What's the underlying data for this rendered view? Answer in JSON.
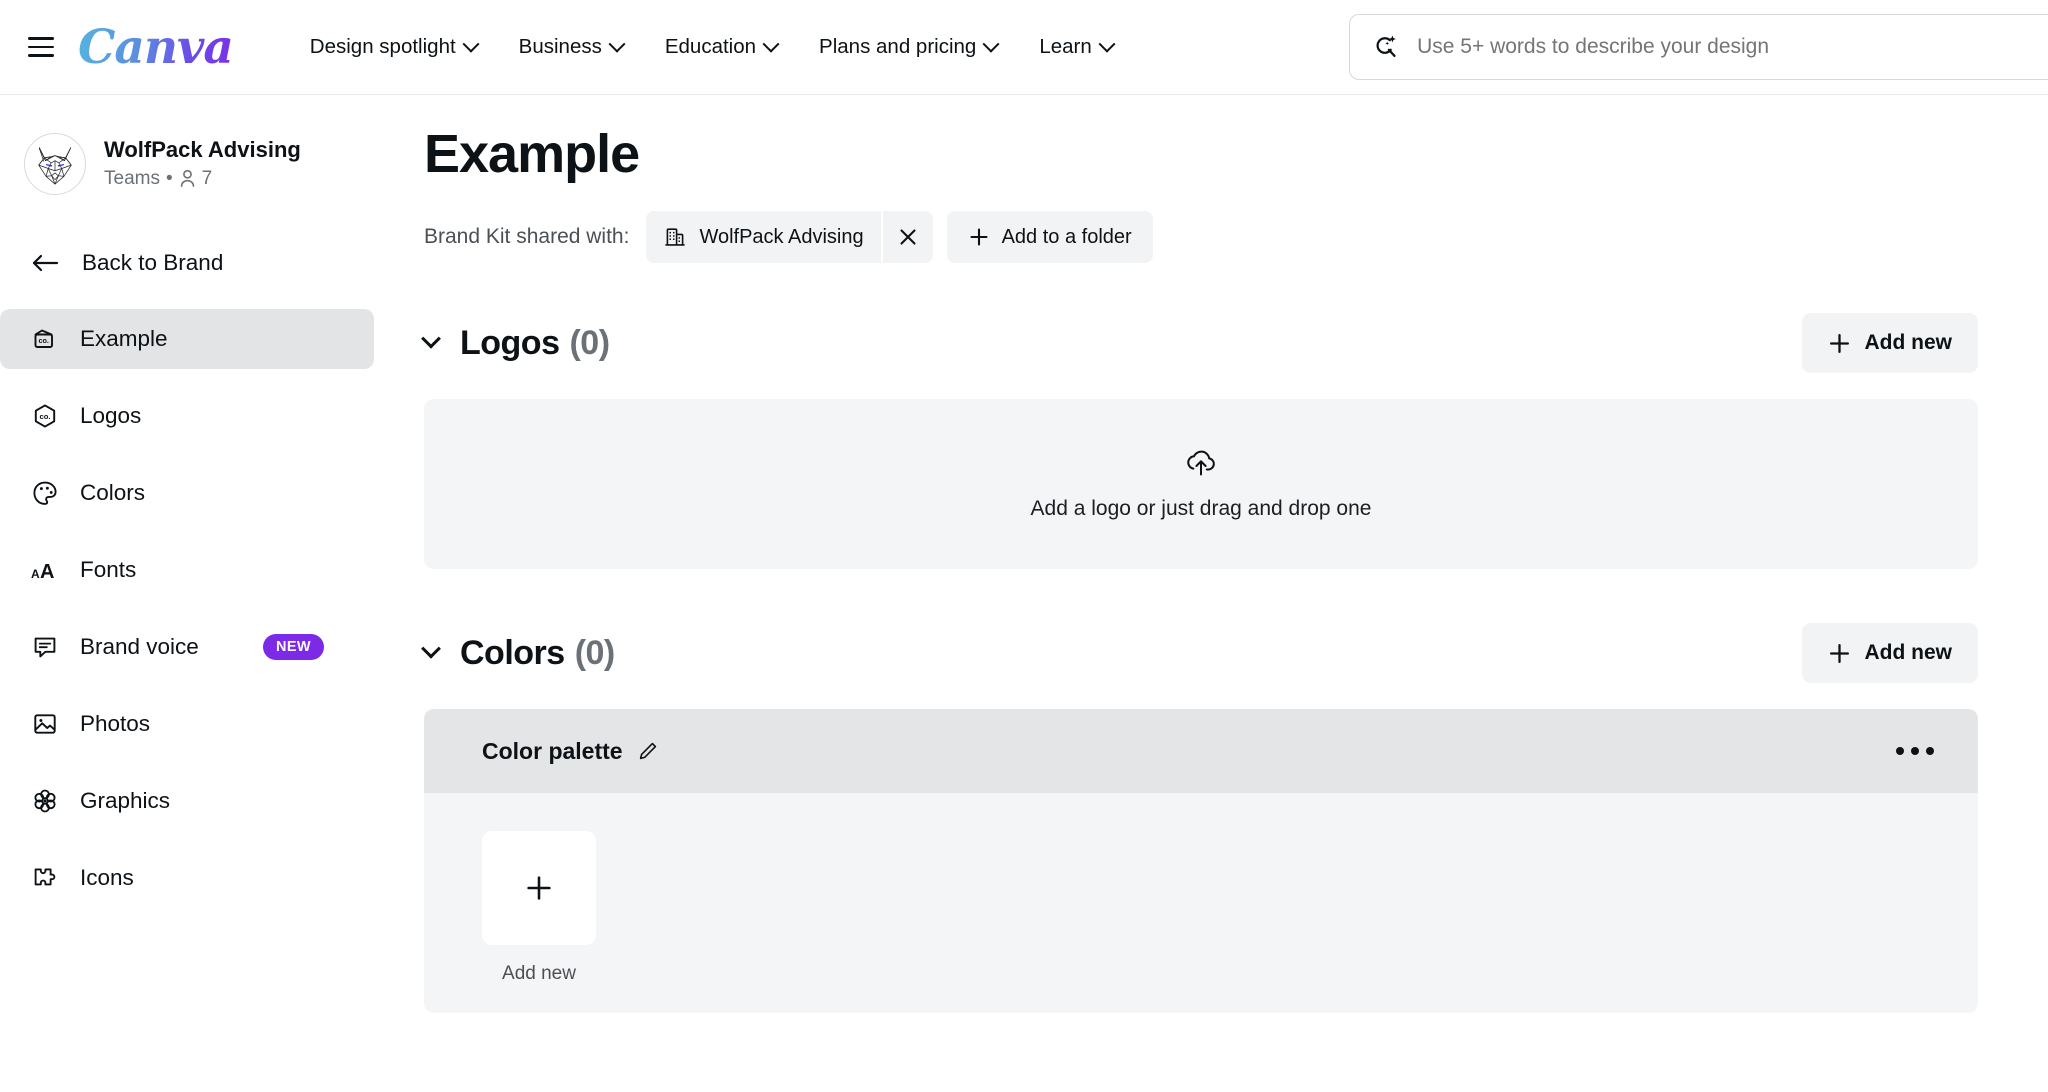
{
  "topnav": {
    "menu_icon": "hamburger-icon",
    "logo_text": "Canva",
    "items": [
      {
        "label": "Design spotlight",
        "icon": "chevron-down-icon"
      },
      {
        "label": "Business",
        "icon": "chevron-down-icon"
      },
      {
        "label": "Education",
        "icon": "chevron-down-icon"
      },
      {
        "label": "Plans and pricing",
        "icon": "chevron-down-icon"
      },
      {
        "label": "Learn",
        "icon": "chevron-down-icon"
      }
    ],
    "search": {
      "icon": "ai-search-icon",
      "placeholder": "Use 5+ words to describe your design",
      "value": ""
    }
  },
  "sidebar": {
    "team": {
      "avatar_icon": "wolf-head-avatar",
      "name": "WolfPack Advising",
      "type": "Teams",
      "separator": "•",
      "members_icon": "person-icon",
      "members_count": "7"
    },
    "back": {
      "icon": "arrow-left-icon",
      "label": "Back to Brand"
    },
    "items": [
      {
        "label": "Example",
        "icon": "brand-kit-icon",
        "active": true,
        "badge": ""
      },
      {
        "label": "Logos",
        "icon": "logo-hexagon-icon",
        "active": false,
        "badge": ""
      },
      {
        "label": "Colors",
        "icon": "palette-icon",
        "active": false,
        "badge": ""
      },
      {
        "label": "Fonts",
        "icon": "font-size-icon",
        "active": false,
        "badge": ""
      },
      {
        "label": "Brand voice",
        "icon": "speech-bubble-icon",
        "active": false,
        "badge": "NEW"
      },
      {
        "label": "Photos",
        "icon": "photo-icon",
        "active": false,
        "badge": ""
      },
      {
        "label": "Graphics",
        "icon": "flower-icon",
        "active": false,
        "badge": ""
      },
      {
        "label": "Icons",
        "icon": "puzzle-piece-icon",
        "active": false,
        "badge": ""
      }
    ]
  },
  "main": {
    "title": "Example",
    "shared": {
      "label": "Brand Kit shared with:",
      "chip_icon": "office-building-icon",
      "chip_text": "WolfPack Advising",
      "chip_remove_icon": "close-icon",
      "add_folder_icon": "plus-icon",
      "add_folder_label": "Add to a folder"
    },
    "logos_section": {
      "collapse_icon": "chevron-down-icon",
      "title": "Logos",
      "count": "(0)",
      "add_new_icon": "plus-icon",
      "add_new_label": "Add new",
      "dropzone_icon": "cloud-upload-icon",
      "dropzone_text": "Add a logo or just drag and drop one"
    },
    "colors_section": {
      "collapse_icon": "chevron-down-icon",
      "title": "Colors",
      "count": "(0)",
      "add_new_icon": "plus-icon",
      "add_new_label": "Add new",
      "palette": {
        "name": "Color palette",
        "edit_icon": "pencil-icon",
        "more_icon": "more-horizontal-icon",
        "add_swatch_icon": "plus-icon",
        "add_swatch_label": "Add new"
      }
    }
  },
  "colors": {
    "accent_purple": "#7d2ae8",
    "logo_gradient_start": "#56b4e0",
    "logo_gradient_end": "#7d2ae8",
    "text_primary": "#0d1216",
    "text_muted": "#6b7177",
    "panel_bg": "#f4f5f6",
    "chip_bg": "#f2f3f4",
    "active_nav_bg": "#e3e4e6",
    "palette_header_bg": "#e4e5e7"
  }
}
